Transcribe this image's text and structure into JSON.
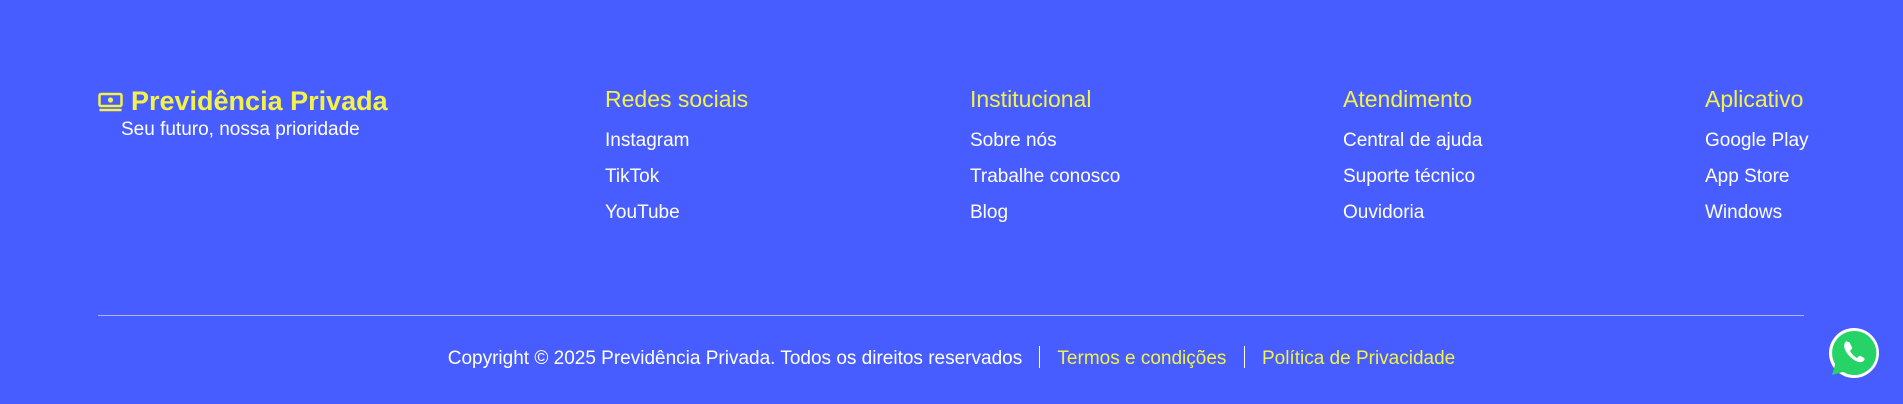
{
  "brand": {
    "title": "Previdência Privada",
    "subtitle": "Seu futuro, nossa prioridade",
    "icon": "money-icon"
  },
  "columns": [
    {
      "heading": "Redes sociais",
      "links": [
        "Instagram",
        "TikTok",
        "YouTube"
      ]
    },
    {
      "heading": "Institucional",
      "links": [
        "Sobre nós",
        "Trabalhe conosco",
        "Blog"
      ]
    },
    {
      "heading": "Atendimento",
      "links": [
        "Central de ajuda",
        "Suporte técnico",
        "Ouvidoria"
      ]
    },
    {
      "heading": "Aplicativo",
      "links": [
        "Google Play",
        "App Store",
        "Windows"
      ]
    }
  ],
  "footer": {
    "copyright": "Copyright © 2025 Previdência Privada. Todos os direitos reservados",
    "terms": "Termos e condições",
    "privacy": "Política de Privacidade"
  },
  "colors": {
    "background": "#485dff",
    "accent": "#f2f24a",
    "text": "#ffffff",
    "whatsapp": "#25d366"
  },
  "floating": {
    "icon": "whatsapp-icon"
  }
}
